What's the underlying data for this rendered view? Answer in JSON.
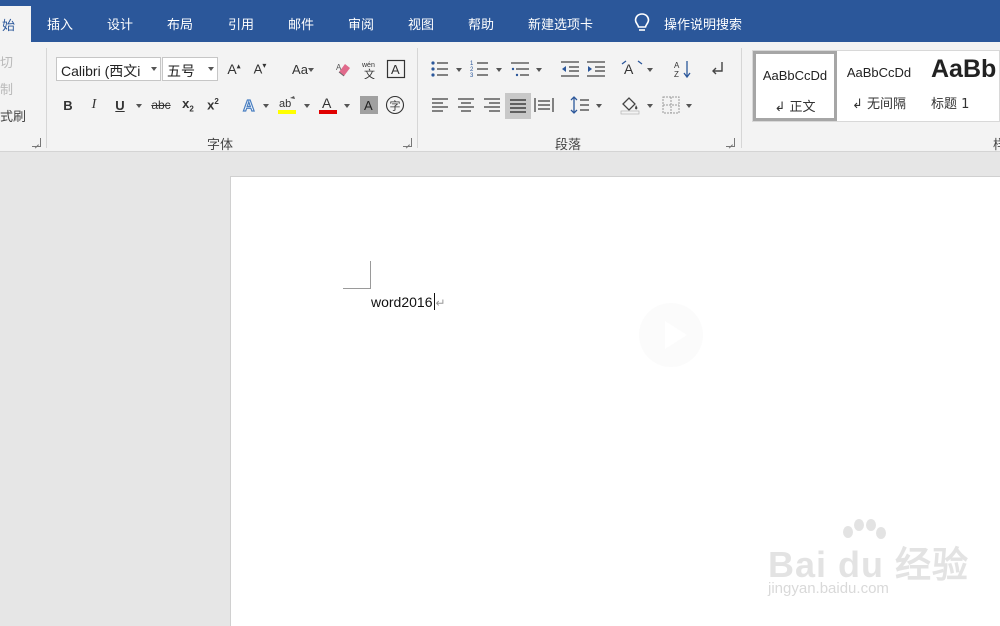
{
  "tabs": [
    {
      "label": "始",
      "active": true
    },
    {
      "label": "插入"
    },
    {
      "label": "设计"
    },
    {
      "label": "布局"
    },
    {
      "label": "引用"
    },
    {
      "label": "邮件"
    },
    {
      "label": "审阅"
    },
    {
      "label": "视图"
    },
    {
      "label": "帮助"
    },
    {
      "label": "新建选项卡"
    }
  ],
  "tell_me": {
    "icon": "lightbulb-icon",
    "label": "操作说明搜索"
  },
  "clipboard": {
    "cut": "切",
    "copy": "制",
    "format_painter": "式刷"
  },
  "font_group": {
    "font_name": "Calibri (西文i",
    "font_size": "五号",
    "label": "字体",
    "text_color": "#e00000",
    "highlight_color": "#ffff00"
  },
  "paragraph_group": {
    "label": "段落"
  },
  "styles_group": {
    "items": [
      {
        "sample": "AaBbCcDd",
        "name": "正文",
        "selected": true
      },
      {
        "sample": "AaBbCcDd",
        "name": "无间隔"
      },
      {
        "sample": "AaBb",
        "name": "标题 1"
      }
    ],
    "label_partial": "样"
  },
  "document": {
    "text": "word2016",
    "paragraph_mark": "↵"
  },
  "watermark": {
    "brand": "Bai du 经验",
    "url": "jingyan.baidu.com"
  },
  "colors": {
    "ribbon_blue": "#2b579a",
    "ribbon_bg": "#f3f3f3",
    "doc_bg": "#e6e6e6"
  }
}
